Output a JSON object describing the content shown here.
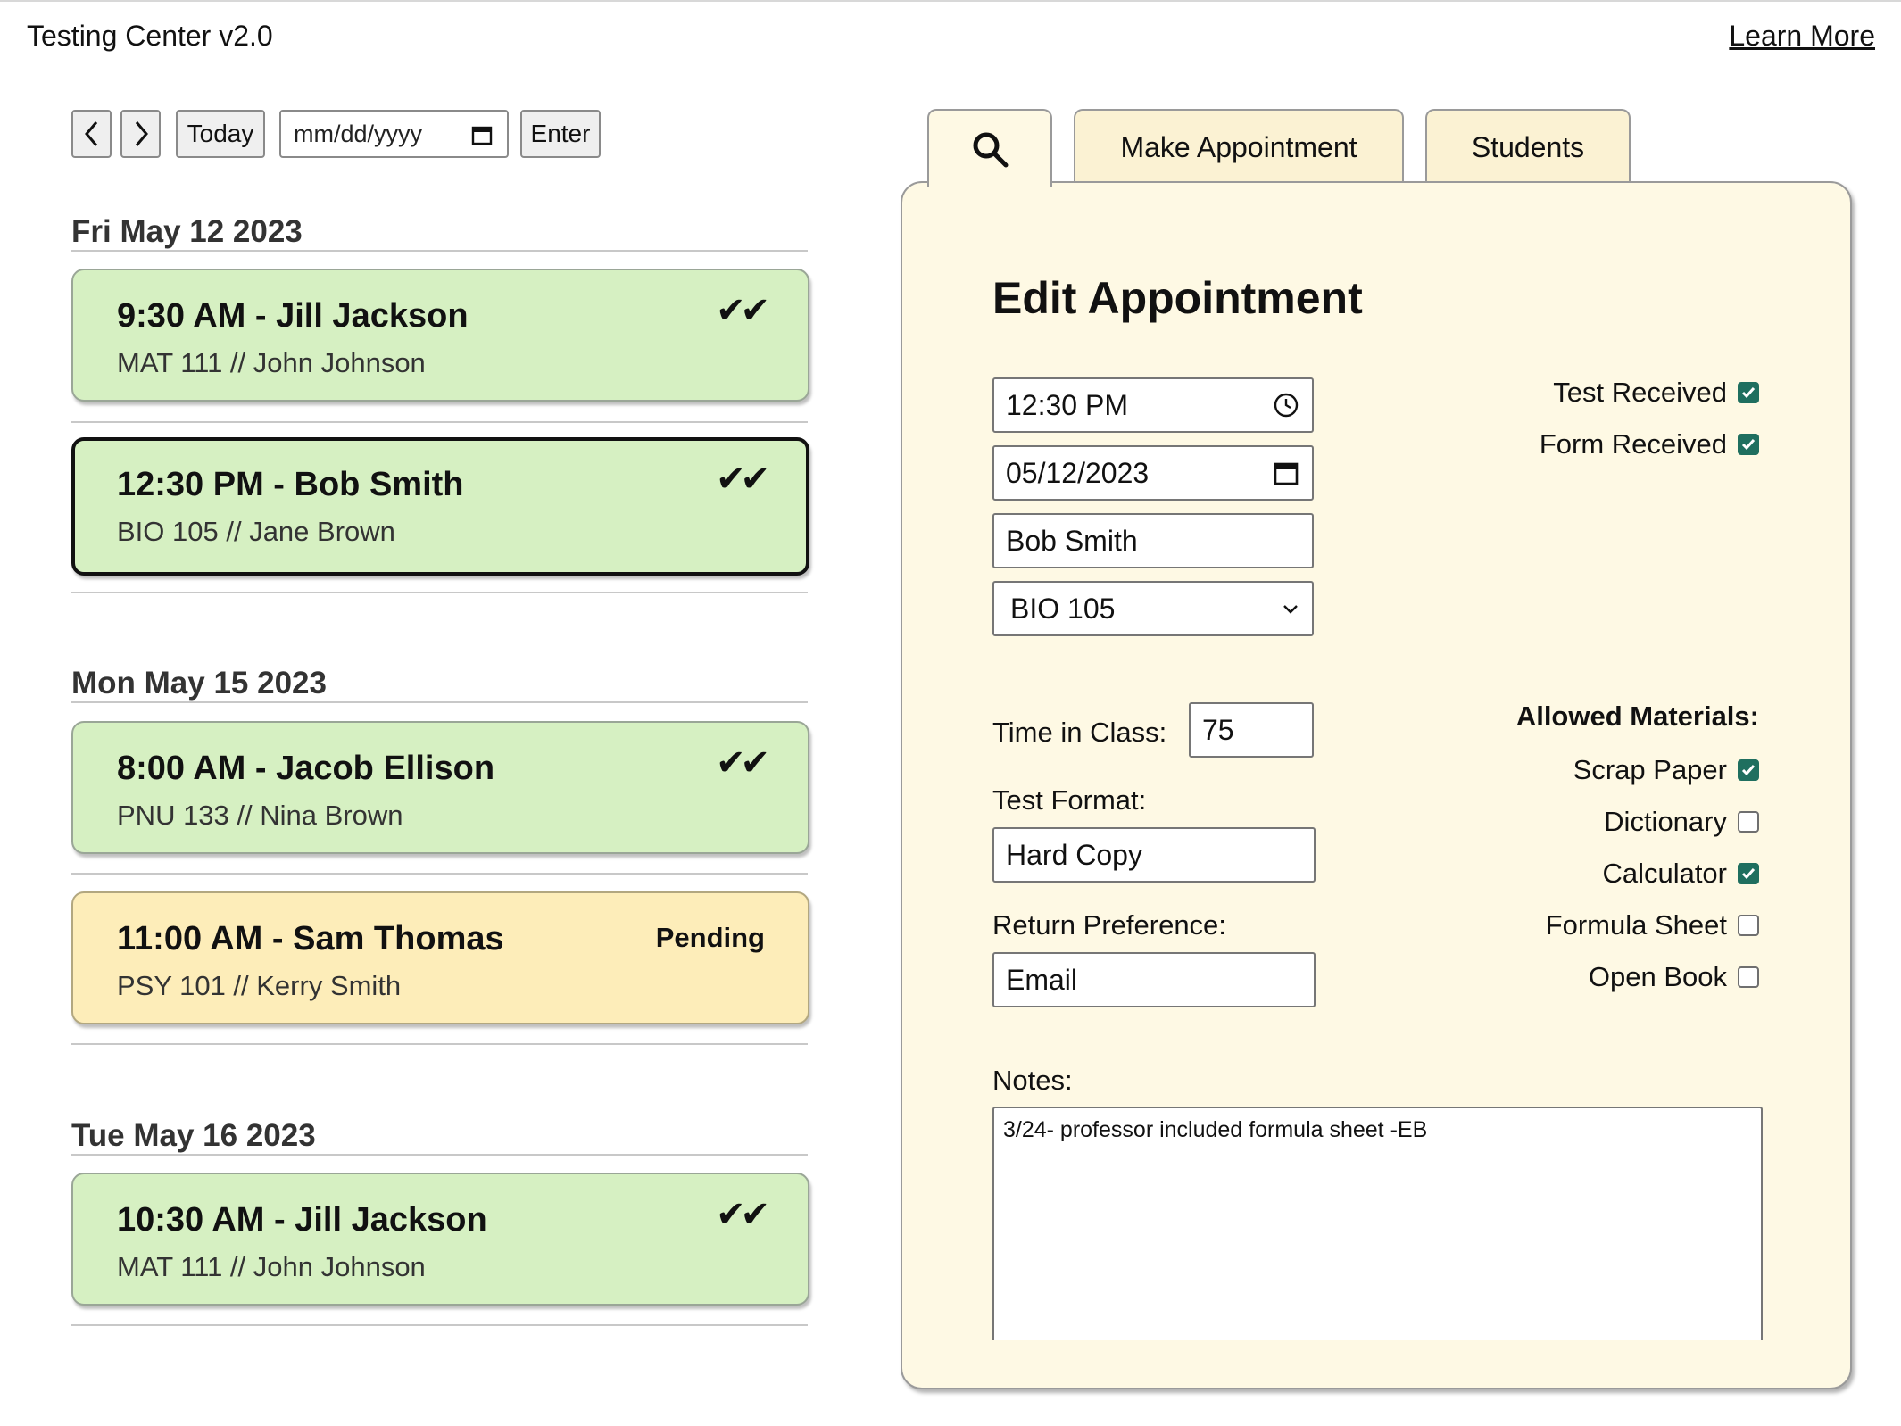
{
  "header": {
    "app_title": "Testing Center v2.0",
    "learn_more": "Learn More"
  },
  "toolbar": {
    "prev_icon": "chevron-left-icon",
    "next_icon": "chevron-right-icon",
    "today_label": "Today",
    "date_placeholder": "mm/dd/yyyy",
    "enter_label": "Enter"
  },
  "schedule": {
    "days": [
      {
        "date": "Fri May 12 2023",
        "appointments": [
          {
            "title": "9:30 AM - Jill Jackson",
            "subtitle": "MAT 111 // John Johnson",
            "status": "✔✔",
            "state": "confirmed"
          },
          {
            "title": "12:30 PM - Bob Smith",
            "subtitle": "BIO 105 // Jane Brown",
            "status": "✔✔",
            "state": "confirmed-selected"
          }
        ]
      },
      {
        "date": "Mon May 15 2023",
        "appointments": [
          {
            "title": "8:00 AM - Jacob Ellison",
            "subtitle": "PNU 133 // Nina Brown",
            "status": "✔✔",
            "state": "confirmed"
          },
          {
            "title": "11:00 AM - Sam Thomas",
            "subtitle": "PSY 101 // Kerry Smith",
            "status": "Pending",
            "state": "pending"
          }
        ]
      },
      {
        "date": "Tue May 16 2023",
        "appointments": [
          {
            "title": "10:30 AM - Jill Jackson",
            "subtitle": "MAT 111 // John Johnson",
            "status": "✔✔",
            "state": "confirmed"
          }
        ]
      }
    ]
  },
  "tabs": [
    {
      "icon": "search-icon",
      "label": "",
      "active": true
    },
    {
      "label": "Make Appointment",
      "active": false
    },
    {
      "label": "Students",
      "active": false
    }
  ],
  "form": {
    "title": "Edit Appointment",
    "time": "12:30 PM",
    "date": "05/12/2023",
    "student": "Bob Smith",
    "course": "BIO 105",
    "time_in_class_label": "Time in Class:",
    "time_in_class": "75",
    "test_format_label": "Test Format:",
    "test_format": "Hard Copy",
    "return_pref_label": "Return Preference:",
    "return_pref": "Email",
    "notes_label": "Notes:",
    "notes": "3/24- professor included formula sheet -EB",
    "test_received_label": "Test Received",
    "test_received": true,
    "form_received_label": "Form Received",
    "form_received": true,
    "materials_label": "Allowed Materials:",
    "materials": [
      {
        "label": "Scrap Paper",
        "checked": true
      },
      {
        "label": "Dictionary",
        "checked": false
      },
      {
        "label": "Calculator",
        "checked": true
      },
      {
        "label": "Formula Sheet",
        "checked": false
      },
      {
        "label": "Open Book",
        "checked": false
      }
    ]
  },
  "colors": {
    "confirmed_bg": "#d6f0c2",
    "pending_bg": "#fdedb9",
    "panel_bg": "#fef9e4",
    "checkbox_on": "#1f6f5f"
  }
}
